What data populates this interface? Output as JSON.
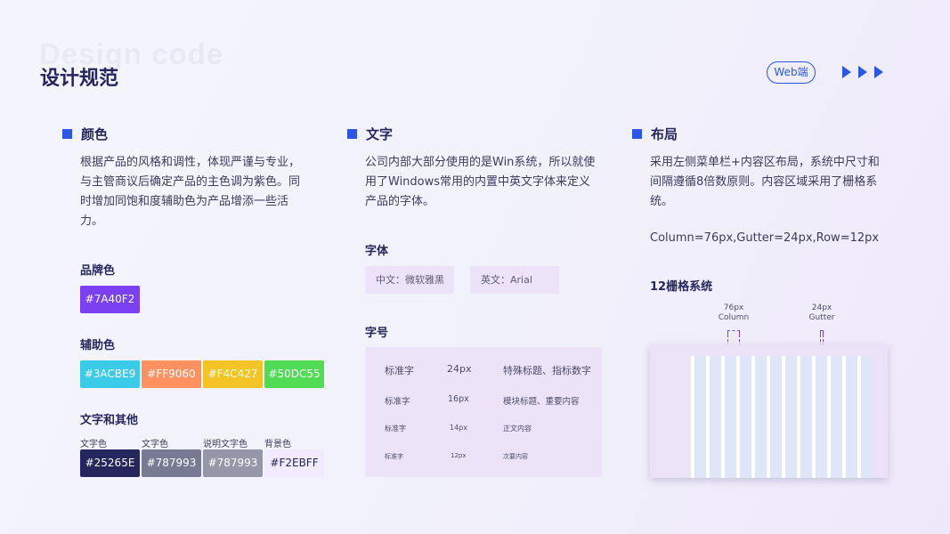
{
  "header": {
    "bg_title": "Design code",
    "title": "设计规范",
    "badge": "Web端"
  },
  "colors": {
    "accent": "#2b56e8",
    "heading": "颜色",
    "desc": [
      "根据产品的风格和调性，体现严谨与专业，",
      "与主管商议后确定产品的主色调为紫色。同",
      "时增加同饱和度辅助色为产品增添一些活",
      "力。"
    ],
    "brand_label": "品牌色",
    "brand": {
      "value": "#7A40F2",
      "color": "#7A40F2"
    },
    "aux_label": "辅助色",
    "aux": [
      {
        "value": "#3ACBE9",
        "color": "#3ACBE9"
      },
      {
        "value": "#FF9060",
        "color": "#FF9060"
      },
      {
        "value": "#F4C427",
        "color": "#F4C427"
      },
      {
        "value": "#50DC55",
        "color": "#50DC55"
      }
    ],
    "other_label": "文字和其他",
    "other": [
      {
        "label": "文字色",
        "value": "#25265E",
        "color": "#25265E"
      },
      {
        "label": "文字色",
        "value": "#787993",
        "color": "#787993"
      },
      {
        "label": "说明文字色",
        "value": "#787993",
        "color": "#9596a8"
      },
      {
        "label": "背景色",
        "value": "#F2EBFF",
        "color": "#F2EBFF"
      }
    ]
  },
  "text": {
    "heading": "文字",
    "desc": [
      "公司内部大部分使用的是Win系统，所以就使",
      "用了Windows常用的内置中英文字体来定义",
      "产品的字体。"
    ],
    "font_label": "字体",
    "fonts": [
      "中文：微软雅黑",
      "英文：Arial"
    ],
    "size_label": "字号",
    "sizes": [
      {
        "name": "标准字",
        "size": "24px",
        "usage": "特殊标题、指标数字"
      },
      {
        "name": "标准字",
        "size": "16px",
        "usage": "模块标题、重要内容"
      },
      {
        "name": "标准字",
        "size": "14px",
        "usage": "正文内容"
      },
      {
        "name": "标准字",
        "size": "12px",
        "usage": "次要内容"
      }
    ]
  },
  "layout": {
    "heading": "布局",
    "desc": [
      "采用左侧菜单栏+内容区布局，系统中尺寸和",
      "间隔遵循8倍数原则。内容区域采用了栅格系",
      "统。"
    ],
    "spec": "Column=76px,Gutter=24px,Row=12px",
    "grid_label": "12栅格系统",
    "column_size": "76px",
    "column_name": "Column",
    "gutter_size": "24px",
    "gutter_name": "Gutter",
    "columns": 12
  }
}
